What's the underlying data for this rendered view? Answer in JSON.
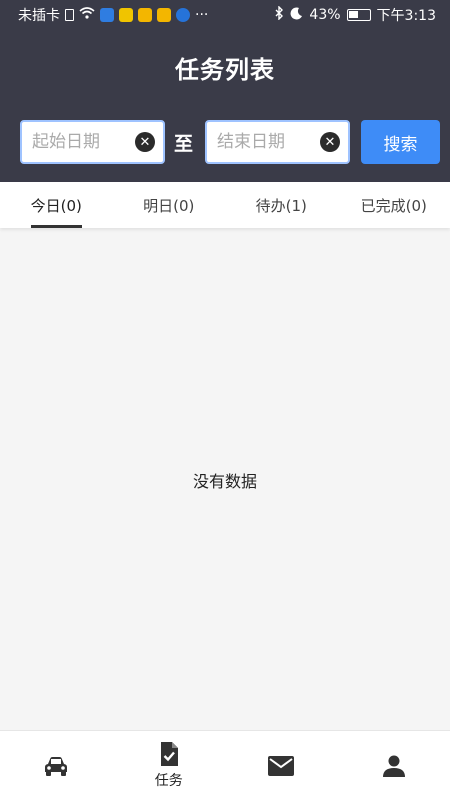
{
  "status_bar": {
    "carrier": "未插卡",
    "more": "···",
    "battery_percent": "43%",
    "battery_level": 0.43,
    "time": "下午3:13"
  },
  "header": {
    "title": "任务列表",
    "start_placeholder": "起始日期",
    "end_placeholder": "结束日期",
    "to_label": "至",
    "search_label": "搜索"
  },
  "tabs": [
    {
      "label": "今日(0)",
      "active": true
    },
    {
      "label": "明日(0)",
      "active": false
    },
    {
      "label": "待办(1)",
      "active": false
    },
    {
      "label": "已完成(0)",
      "active": false
    }
  ],
  "empty_text": "没有数据",
  "bottom_nav": [
    {
      "icon": "car-icon",
      "label": ""
    },
    {
      "icon": "task-check-icon",
      "label": "任务"
    },
    {
      "icon": "mail-icon",
      "label": ""
    },
    {
      "icon": "user-icon",
      "label": ""
    }
  ],
  "colors": {
    "header_bg": "#3a3b48",
    "accent": "#3e8cf7",
    "page_bg": "#f5f5f5"
  }
}
